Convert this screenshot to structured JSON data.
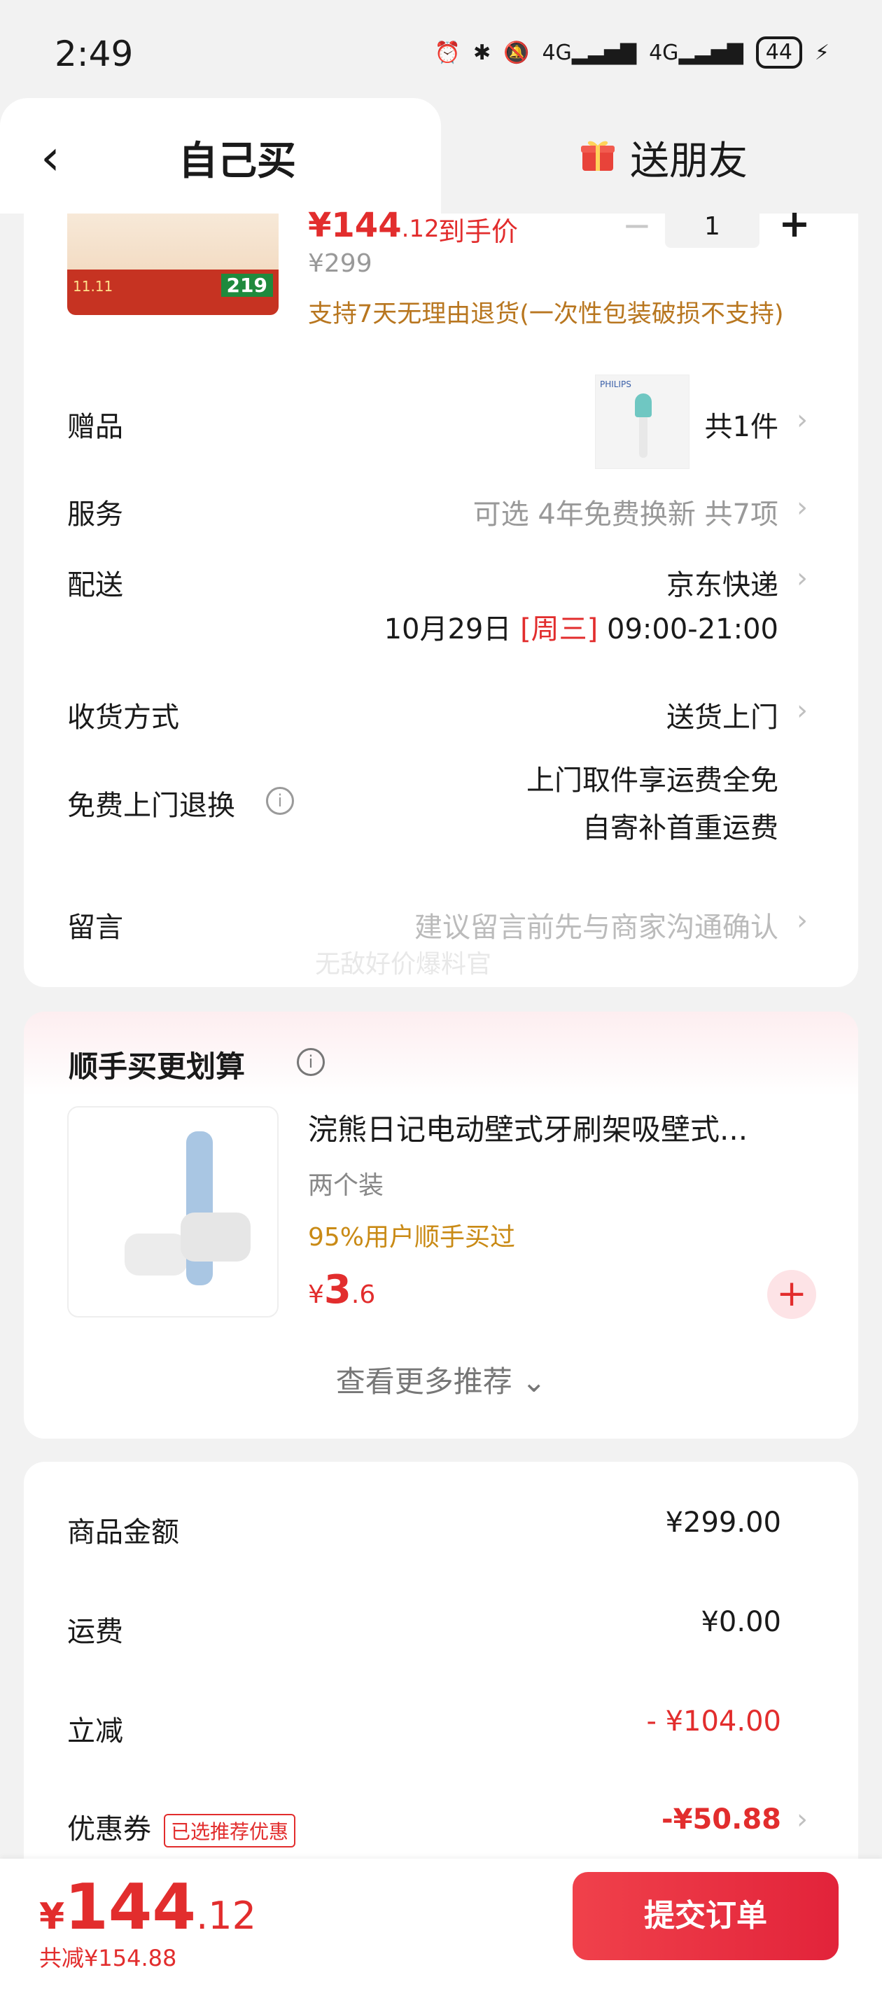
{
  "status_bar": {
    "time": "2:49",
    "icons": [
      "alarm-icon",
      "bluetooth-icon",
      "vibrate-icon",
      "mute-icon",
      "signal-4g-icon",
      "signal-4g-icon"
    ],
    "net_label": "4G",
    "net_label_2": "4G",
    "battery": "44"
  },
  "tabs": {
    "self_buy": "自己买",
    "send_friend": "送朋友"
  },
  "product": {
    "price_symbol": "¥",
    "price_int": "144",
    "price_dec": ".12",
    "price_tag": "到手价",
    "original_price": "¥299",
    "quantity": "1",
    "return_policy": "支持7天无理由退货(一次性包装破损不支持)",
    "thumb_price": "219"
  },
  "rows": {
    "gift_label": "赠品",
    "gift_value": "共1件",
    "service_label": "服务",
    "service_value": "可选 4年免费换新 共7项",
    "delivery_label": "配送",
    "delivery_value": "京东快递",
    "delivery_date": "10月29日",
    "delivery_weekday": "[周三]",
    "delivery_time": "09:00-21:00",
    "receive_label": "收货方式",
    "receive_value": "送货上门",
    "return_label": "免费上门退换",
    "return_line1": "上门取件享运费全免",
    "return_line2": "自寄补首重运费",
    "message_label": "留言",
    "message_placeholder": "建议留言前先与商家沟通确认",
    "watermark": "无敌好价爆料官"
  },
  "recommend": {
    "title": "顺手买更划算",
    "item_name": "浣熊日记电动壁式牙刷架吸壁式...",
    "item_spec": "两个装",
    "item_social": "95%用户顺手买过",
    "item_price_symbol": "¥",
    "item_price_int": "3",
    "item_price_dec": ".6",
    "see_more": "查看更多推荐"
  },
  "summary": {
    "goods_label": "商品金额",
    "goods_value": "¥299.00",
    "shipping_label": "运费",
    "shipping_value": "¥0.00",
    "discount_label": "立减",
    "discount_value": "- ¥104.00",
    "coupon_label": "优惠券",
    "coupon_tag": "已选推荐优惠",
    "coupon_value": "-¥50.88"
  },
  "bottom": {
    "currency": "¥",
    "total_int": "144",
    "total_dec": ".12",
    "saved": "共减¥154.88",
    "submit": "提交订单"
  },
  "colors": {
    "accent_red": "#e22d2d",
    "policy_gold": "#b8761f",
    "button_red": "#e8273c"
  }
}
